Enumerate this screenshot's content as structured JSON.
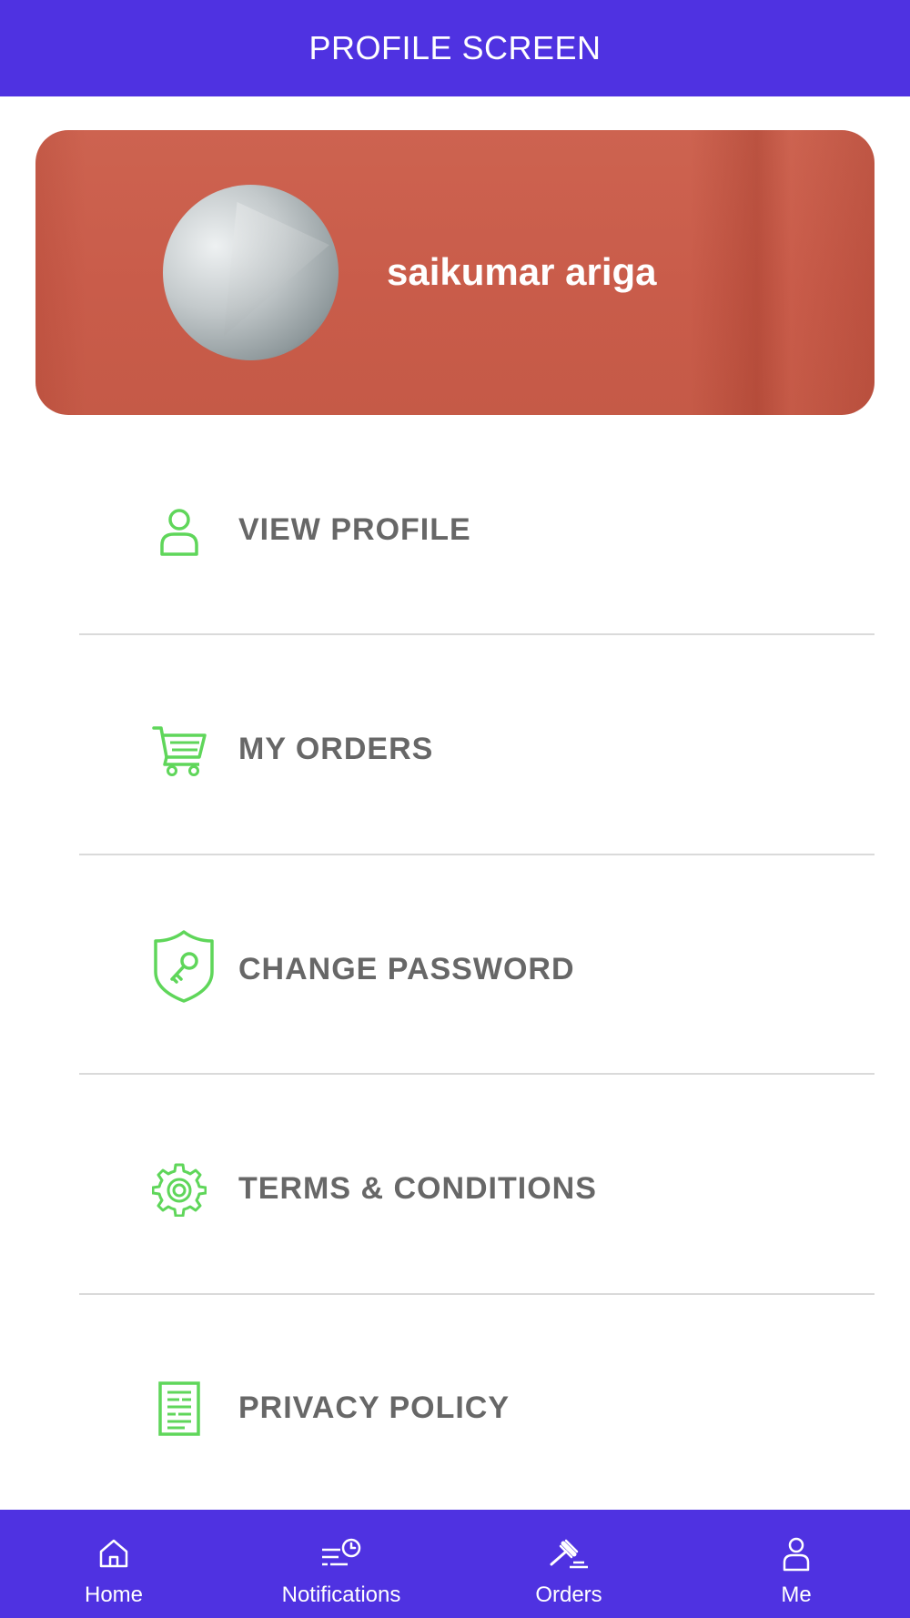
{
  "header": {
    "title": "PROFILE SCREEN"
  },
  "profile": {
    "name": "saikumar ariga",
    "avatar_icon": "profile-photo"
  },
  "menu": {
    "accent_color": "#5fd65a",
    "items": [
      {
        "label": "VIEW PROFILE",
        "icon": "person-icon"
      },
      {
        "label": "MY ORDERS",
        "icon": "cart-icon"
      },
      {
        "label": "CHANGE PASSWORD",
        "icon": "shield-key-icon"
      },
      {
        "label": "TERMS & CONDITIONS",
        "icon": "gear-icon"
      },
      {
        "label": "PRIVACY POLICY",
        "icon": "document-icon"
      }
    ]
  },
  "bottom_nav": {
    "background": "#4f32e1",
    "items": [
      {
        "label": "Home",
        "icon": "home-icon"
      },
      {
        "label": "Notifications",
        "icon": "notifications-clock-icon"
      },
      {
        "label": "Orders",
        "icon": "gavel-icon"
      },
      {
        "label": "Me",
        "icon": "person-icon"
      }
    ]
  }
}
